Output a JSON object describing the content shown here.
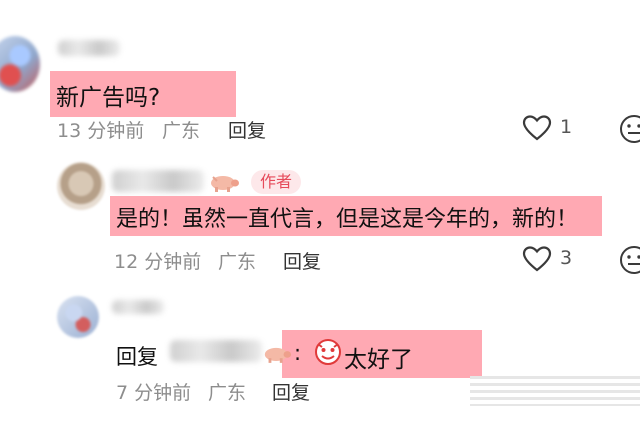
{
  "comments": [
    {
      "text": "新广告吗?",
      "time": "13 分钟前",
      "location": "广东",
      "reply_label": "回复",
      "likes": "1"
    },
    {
      "author_badge": "作者",
      "text": "是的！虽然一直代言，但是这是今年的，新的！",
      "time": "12 分钟前",
      "location": "广东",
      "reply_label": "回复",
      "likes": "3"
    },
    {
      "reply_prefix": "回复",
      "colon": ":",
      "text": "太好了",
      "time": "7 分钟前",
      "location": "广东",
      "reply_label": "回复"
    }
  ],
  "icons": {
    "heart": "heart-icon",
    "emoji": "emoji-face-icon",
    "pig": "pig-emoji-icon",
    "sticker": "red-face-sticker-icon"
  },
  "colors": {
    "highlight": "#ff9aa6",
    "author_badge": "#e64b5b",
    "meta_text": "#8d8d8d"
  }
}
